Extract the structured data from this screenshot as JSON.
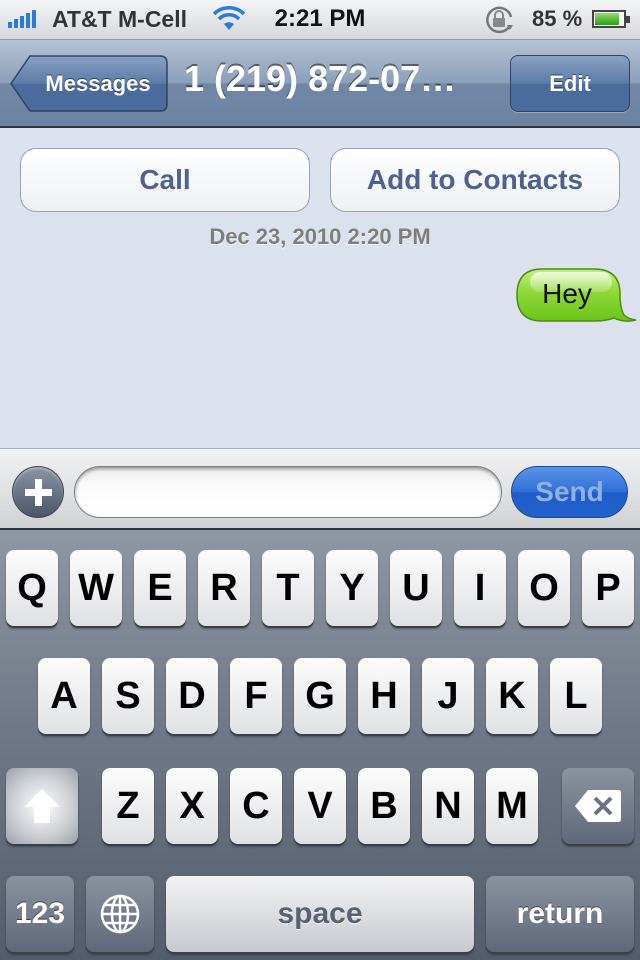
{
  "status_bar": {
    "signal_bars": 5,
    "carrier": "AT&T M-Cell",
    "wifi_icon": "wifi-icon",
    "time": "2:21 PM",
    "rotation_lock_icon": "rotation-lock-icon",
    "battery_percent_label": "85 %",
    "battery_level": 0.85
  },
  "nav_bar": {
    "back_label": "Messages",
    "title": "1 (219) 872-07…",
    "edit_label": "Edit"
  },
  "conversation": {
    "call_label": "Call",
    "add_contact_label": "Add to Contacts",
    "timestamp": "Dec 23, 2010 2:20 PM",
    "messages": [
      {
        "direction": "outgoing",
        "text": "Hey",
        "color": "#7ed321"
      }
    ]
  },
  "input_bar": {
    "attach_icon": "plus-icon",
    "text_value": "",
    "placeholder": "",
    "send_label": "Send"
  },
  "keyboard": {
    "row1": [
      "Q",
      "W",
      "E",
      "R",
      "T",
      "Y",
      "U",
      "I",
      "O",
      "P"
    ],
    "row2": [
      "A",
      "S",
      "D",
      "F",
      "G",
      "H",
      "J",
      "K",
      "L"
    ],
    "row3": [
      "Z",
      "X",
      "C",
      "V",
      "B",
      "N",
      "M"
    ],
    "shift_icon": "shift-arrow-icon",
    "delete_icon": "backspace-icon",
    "numbers_label": "123",
    "globe_icon": "globe-icon",
    "space_label": "space",
    "return_label": "return"
  }
}
